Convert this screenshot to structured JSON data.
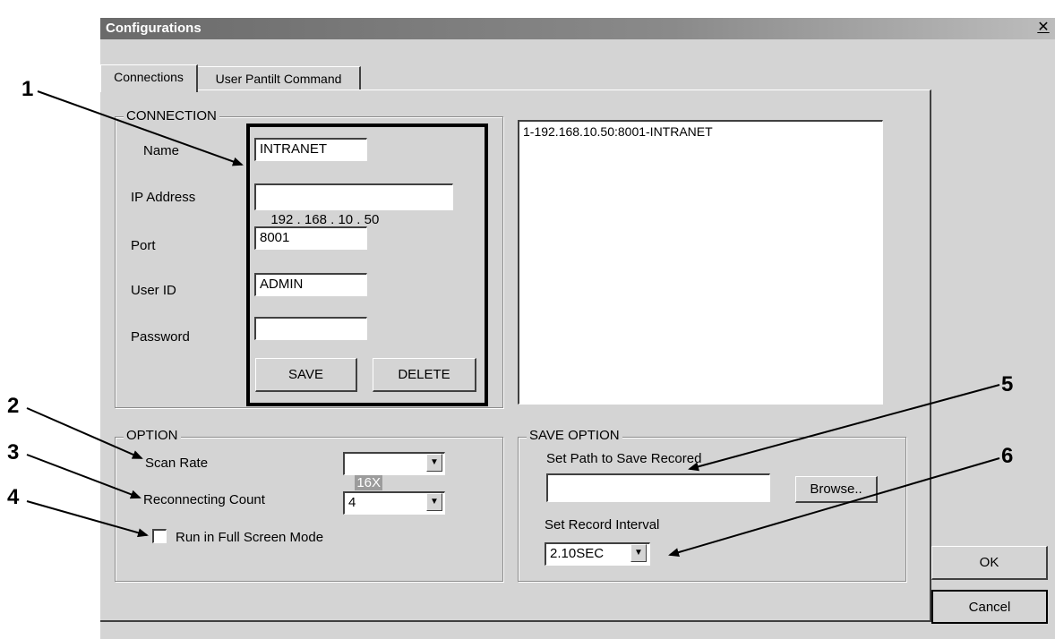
{
  "window": {
    "title": "Configurations",
    "close_icon": "close-icon (×)"
  },
  "tabs": [
    {
      "label": "Connections",
      "active": true
    },
    {
      "label": "User Pantilt Command",
      "active": false
    }
  ],
  "connection": {
    "group_label": "CONNECTION",
    "name_label": "Name",
    "name_value": "INTRANET",
    "ip_label": "IP Address",
    "ip_octets": [
      "192",
      "168",
      "10",
      "50"
    ],
    "port_label": "Port",
    "port_value": "8001",
    "userid_label": "User ID",
    "userid_value": "ADMIN",
    "password_label": "Password",
    "password_value": "",
    "save_label": "SAVE",
    "delete_label": "DELETE"
  },
  "connection_list": [
    "1-192.168.10.50:8001-INTRANET"
  ],
  "option": {
    "group_label": "OPTION",
    "scan_rate_label": "Scan Rate",
    "scan_rate_value": "16X",
    "reconnect_label": "Reconnecting Count",
    "reconnect_value": "4",
    "fullscreen_label": "Run in Full Screen Mode",
    "fullscreen_checked": false
  },
  "save_option": {
    "group_label": "SAVE OPTION",
    "path_label": "Set Path to Save Recored",
    "path_value": "",
    "browse_label": "Browse..",
    "interval_label": "Set Record Interval",
    "interval_value": "2.10SEC"
  },
  "buttons": {
    "ok_label": "OK",
    "cancel_label": "Cancel"
  },
  "callouts": [
    "1",
    "2",
    "3",
    "4",
    "5",
    "6"
  ]
}
